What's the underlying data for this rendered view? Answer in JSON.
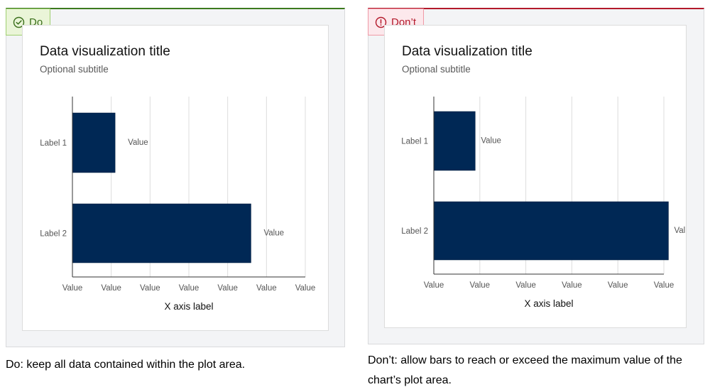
{
  "panels": {
    "do": {
      "badge_label": "Do",
      "icon": "check-circle-icon",
      "accent_color": "#3c7a1e",
      "card_title": "Data visualization title",
      "card_subtitle": "Optional subtitle",
      "caption": "Do: keep all data contained within the plot area."
    },
    "dont": {
      "badge_label": "Don’t",
      "icon": "alert-circle-icon",
      "accent_color": "#b3192b",
      "card_title": "Data visualization title",
      "card_subtitle": "Optional subtitle",
      "caption": "Don’t: allow bars to reach or exceed the maximum value of the chart’s plot area."
    }
  },
  "chart_data": [
    {
      "type": "bar",
      "orientation": "horizontal",
      "title": "Data visualization title",
      "subtitle": "Optional subtitle",
      "categories": [
        "Label 1",
        "Label 2"
      ],
      "values": [
        1.1,
        4.6
      ],
      "value_labels": [
        "Value",
        "Value"
      ],
      "x_ticks": [
        "Value",
        "Value",
        "Value",
        "Value",
        "Value",
        "Value",
        "Value"
      ],
      "xlabel": "X axis label",
      "ylabel": "",
      "xlim": [
        0,
        6
      ],
      "grid": true,
      "bar_color": "#002855"
    },
    {
      "type": "bar",
      "orientation": "horizontal",
      "title": "Data visualization title",
      "subtitle": "Optional subtitle",
      "categories": [
        "Label 1",
        "Label 2"
      ],
      "values": [
        0.9,
        5.1
      ],
      "value_labels": [
        "Value",
        "Val"
      ],
      "x_ticks": [
        "Value",
        "Value",
        "Value",
        "Value",
        "Value",
        "Value"
      ],
      "xlabel": "X axis label",
      "ylabel": "",
      "xlim": [
        0,
        5
      ],
      "grid": true,
      "bar_color": "#002855"
    }
  ]
}
